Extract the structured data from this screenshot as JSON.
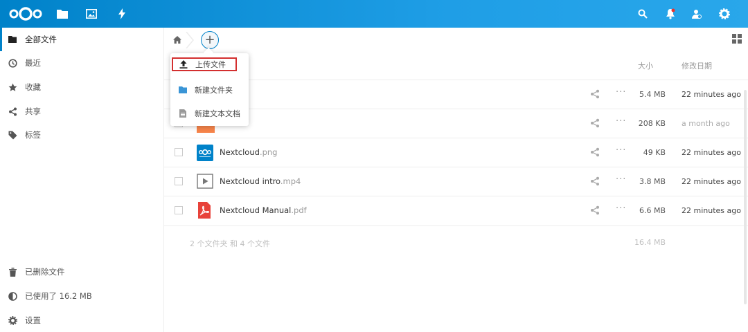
{
  "header": {
    "apps": [
      "files-icon",
      "photos-icon",
      "activity-icon"
    ],
    "actions": [
      "search-icon",
      "notifications-icon",
      "contacts-icon",
      "settings-icon"
    ],
    "brand_color": "#0082c9"
  },
  "sidebar": {
    "items": [
      {
        "label": "全部文件",
        "icon": "folder-icon",
        "active": true
      },
      {
        "label": "最近",
        "icon": "clock-icon"
      },
      {
        "label": "收藏",
        "icon": "star-icon"
      },
      {
        "label": "共享",
        "icon": "share-icon"
      },
      {
        "label": "标签",
        "icon": "tag-icon"
      }
    ],
    "bottom": [
      {
        "label": "已删除文件",
        "icon": "trash-icon"
      },
      {
        "label": "已使用了 16.2 MB",
        "icon": "quota-icon"
      },
      {
        "label": "设置",
        "icon": "gear-icon"
      }
    ]
  },
  "toolbar": {
    "add_label": "+"
  },
  "new_menu": {
    "items": [
      {
        "label": "上传文件",
        "icon": "upload-icon"
      },
      {
        "label": "新建文件夹",
        "icon": "folder-icon"
      },
      {
        "label": "新建文本文档",
        "icon": "text-file-icon"
      }
    ]
  },
  "table": {
    "headers": {
      "size": "大小",
      "date": "修改日期"
    },
    "rows": [
      {
        "name": "",
        "ext": "",
        "size": "5.4 MB",
        "date": "22 minutes ago"
      },
      {
        "name": "",
        "ext": "",
        "size": "208 KB",
        "date": "a month ago"
      },
      {
        "name": "Nextcloud",
        "ext": ".png",
        "size": "49 KB",
        "date": "22 minutes ago"
      },
      {
        "name": "Nextcloud intro",
        "ext": ".mp4",
        "size": "3.8 MB",
        "date": "22 minutes ago"
      },
      {
        "name": "Nextcloud Manual",
        "ext": ".pdf",
        "size": "6.6 MB",
        "date": "22 minutes ago"
      }
    ],
    "more_label": "···",
    "summary": {
      "text": "2 个文件夹 和 4 个文件",
      "size": "16.4 MB"
    }
  }
}
